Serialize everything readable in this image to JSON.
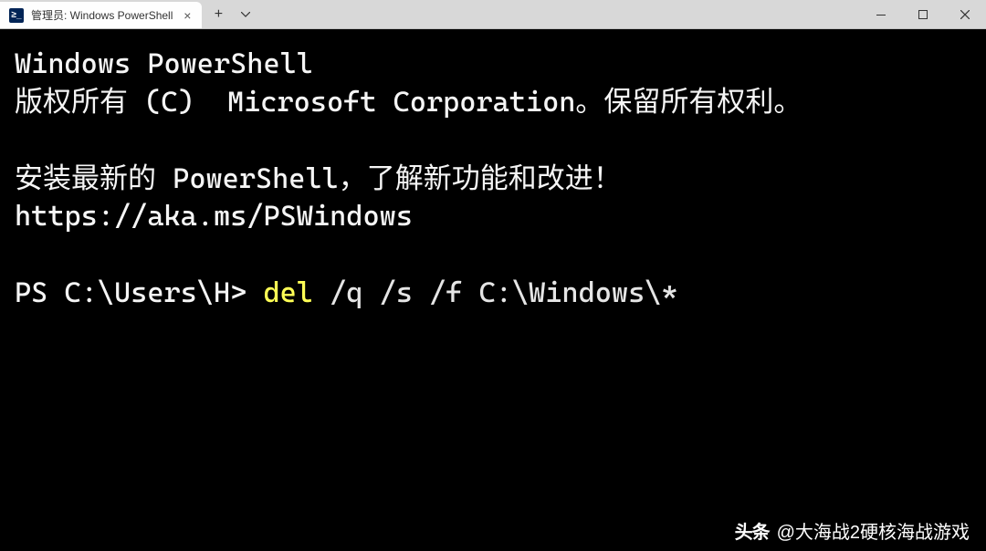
{
  "titlebar": {
    "tab_icon_text": "≥_",
    "tab_title": "管理员: Windows PowerShell",
    "tab_close": "×",
    "new_tab": "+",
    "minimize": "—",
    "maximize": "☐",
    "close": "×"
  },
  "terminal": {
    "line1": "Windows PowerShell",
    "line2": "版权所有 (C)  Microsoft Corporation。保留所有权利。",
    "line3": "",
    "line4": "安装最新的 PowerShell，了解新功能和改进！",
    "line5": "https://aka.ms/PSWindows",
    "line6": "",
    "prompt": "PS C:\\Users\\H> ",
    "cmd_keyword": "del",
    "cmd_args": " /q /s /f C:\\Windows\\*"
  },
  "watermark": {
    "logo": "头条",
    "text": "@大海战2硬核海战游戏"
  }
}
